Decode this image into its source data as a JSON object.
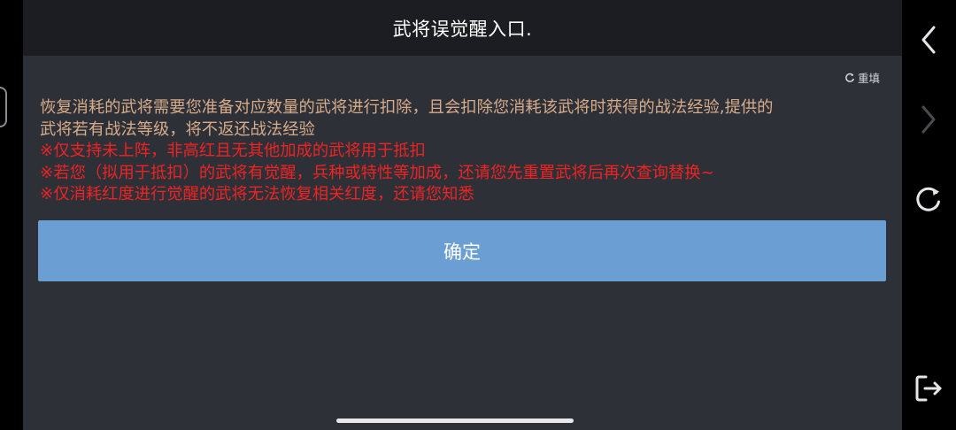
{
  "header": {
    "title": "武将误觉醒入口."
  },
  "reset": {
    "label": "重填",
    "icon": "refresh-small-icon"
  },
  "content": {
    "description": [
      "恢复消耗的武将需要您准备对应数量的武将进行扣除，且会扣除您消耗该武将时获得的战法经验,提供的",
      "武将若有战法等级，将不返还战法经验"
    ],
    "notes": [
      "※仅支持未上阵，非高红且无其他加成的武将用于抵扣",
      "※若您（拟用于抵扣）的武将有觉醒，兵种或特性等加成，还请您先重置武将后再次查询替换~",
      "※仅消耗红度进行觉醒的武将无法恢复相关红度，还请您知悉"
    ]
  },
  "confirm": {
    "label": "确定"
  },
  "side_nav": {
    "back_icon": "chevron-left-icon",
    "forward_icon": "chevron-right-icon",
    "reload_icon": "refresh-icon",
    "exit_icon": "exit-icon"
  },
  "colors": {
    "title_bar": "#1c1d22",
    "panel": "#2d3037",
    "description_text": "#d7ab8a",
    "warning_text": "#ee2323",
    "button": "#6b9fd4"
  }
}
